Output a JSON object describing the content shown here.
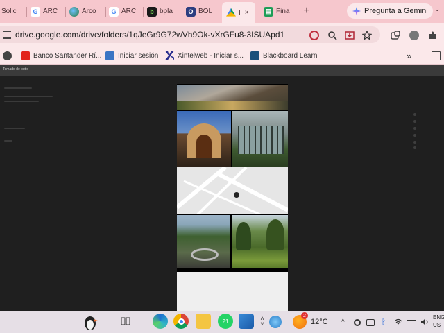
{
  "tabs": [
    {
      "label": "Solic",
      "icon": "document-icon",
      "color": "#d4d4d4"
    },
    {
      "label": "ARC",
      "icon": "google-icon",
      "color": "#ffffff"
    },
    {
      "label": "Arco",
      "icon": "globe-icon",
      "color": "#3a9b5c"
    },
    {
      "label": "ARC",
      "icon": "google-icon",
      "color": "#ffffff"
    },
    {
      "label": "bpla",
      "icon": "b-logo-icon",
      "color": "#1b1b1b"
    },
    {
      "label": "BOL",
      "icon": "shield-logo-icon",
      "color": "#2c3e80"
    },
    {
      "label": "I",
      "icon": "drive-icon",
      "color": "#fbe8ea",
      "active": true
    },
    {
      "label": "Fina",
      "icon": "sheets-icon",
      "color": "#1e9d57"
    }
  ],
  "new_tab": "+",
  "gemini": {
    "label": "Pregunta a Gemini"
  },
  "tab_scroll": "⌄",
  "omnibox": {
    "url": "drive.google.com/drive/folders/1qJeGr9G72wVh9Ok-vXrGFu8-3ISUApd1"
  },
  "bookmarks": [
    {
      "label": "Banco Santander Rí...",
      "icon": "santander-icon",
      "color": "#e2231a"
    },
    {
      "label": "Iniciar sesión",
      "icon": "mail-icon",
      "color": "#3b75c4"
    },
    {
      "label": "Xintelweb - Iniciar s...",
      "icon": "x-logo-icon",
      "color": "#2a2f8f"
    },
    {
      "label": "Blackboard Learn",
      "icon": "blackboard-icon",
      "color": "#1c4f7a"
    }
  ],
  "bookmarks_more": "»",
  "page": {
    "bar_label": "Tomado de outlo"
  },
  "taskbar": {
    "whatsapp_badge": "21",
    "weather_badge": "2",
    "temperature": "12°C",
    "lang_top": "ENG",
    "lang_bottom": "US"
  },
  "colors": {
    "tabbar": "#f6c7cd",
    "toolbar": "#fbe8ea",
    "page_bg": "#1f1f1f",
    "taskbar": "#e6dfe6"
  }
}
